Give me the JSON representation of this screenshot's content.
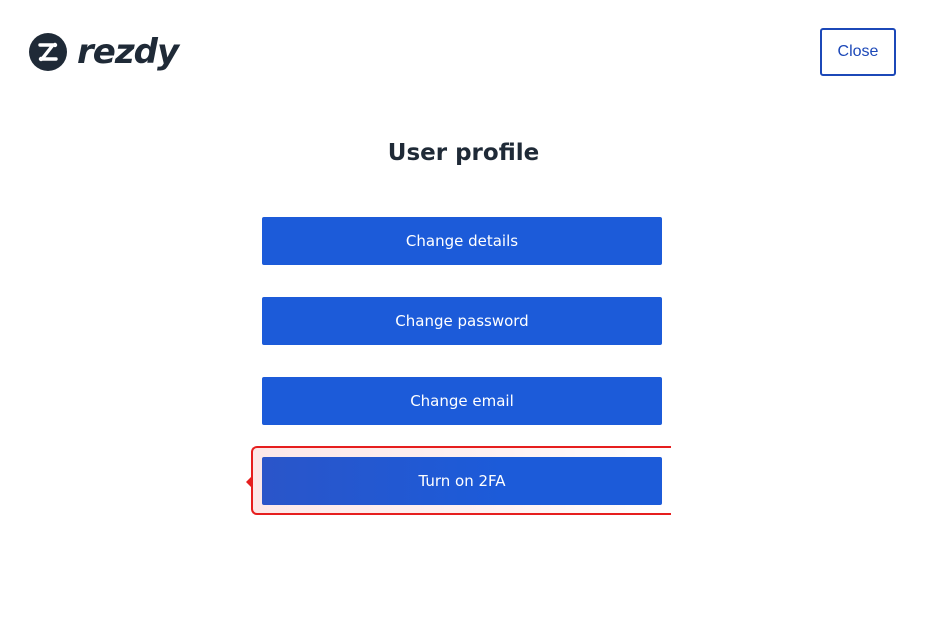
{
  "header": {
    "logo_text": "rezdy",
    "close_label": "Close"
  },
  "main": {
    "title": "User profile",
    "actions": [
      {
        "label": "Change details"
      },
      {
        "label": "Change password"
      },
      {
        "label": "Change email"
      },
      {
        "label": "Turn on 2FA"
      }
    ]
  },
  "colors": {
    "brand_dark": "#1f2a37",
    "primary_button": "#1c5bd9",
    "close_border": "#1c48b8",
    "highlight": "#e61e1e"
  }
}
